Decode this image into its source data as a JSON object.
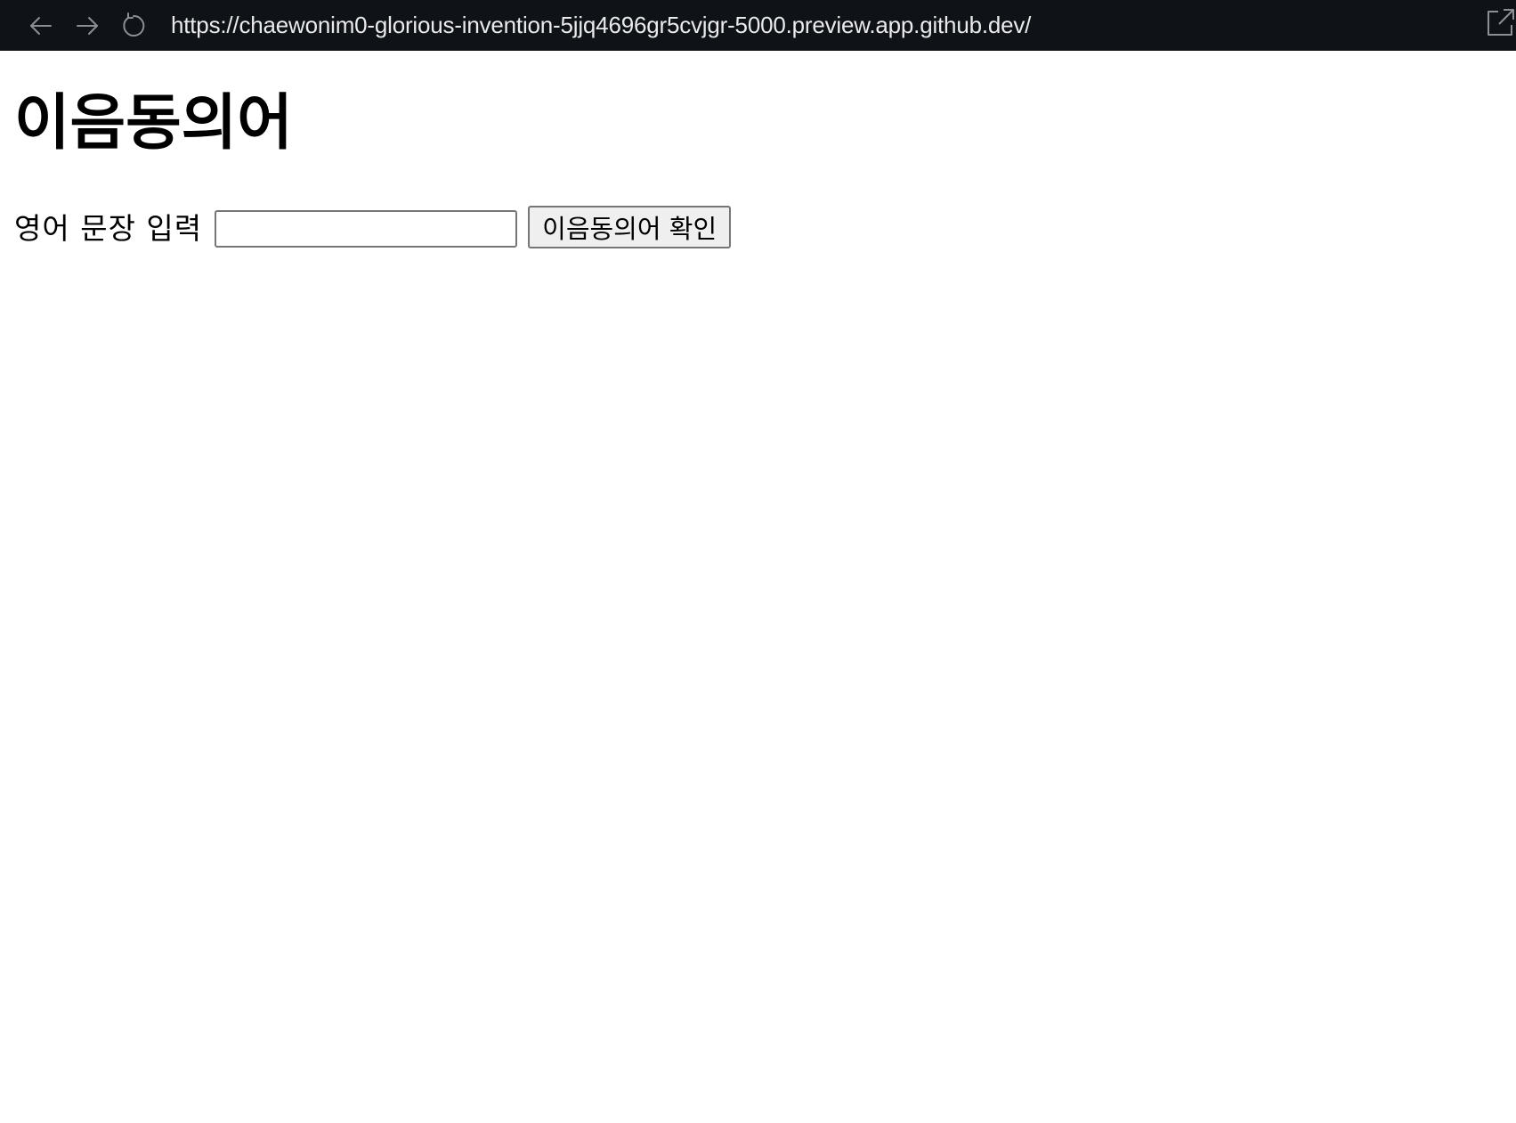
{
  "browser": {
    "url": "https://chaewonim0-glorious-invention-5jjq4696gr5cvjgr-5000.preview.app.github.dev/",
    "back_icon": "arrow-left-icon",
    "forward_icon": "arrow-right-icon",
    "reload_icon": "reload-icon",
    "external_icon": "open-external-icon"
  },
  "page": {
    "title": "이음동의어",
    "form": {
      "label": "영어 문장 입력",
      "input_value": "",
      "input_placeholder": "",
      "submit_label": "이음동의어 확인"
    }
  },
  "colors": {
    "browser_bar": "#0f1216",
    "url_text": "#e8eaed",
    "icon": "#8b8f96",
    "button_bg": "#efefef",
    "border": "#767676"
  }
}
